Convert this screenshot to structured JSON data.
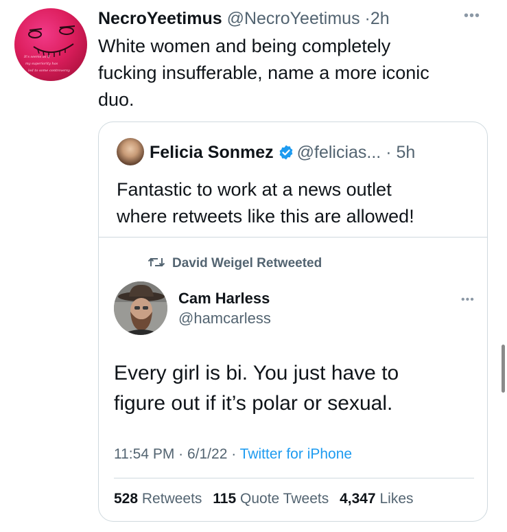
{
  "main_tweet": {
    "display_name": "NecroYeetimus",
    "handle": "@NecroYeetimus",
    "separator": "·",
    "time": "2h",
    "text_lines": [
      "White women and being completely",
      "fucking insufferable, name a more iconic",
      "duo."
    ],
    "avatar_text_lines": [
      "It's seems as if",
      "my superiority has",
      "led to some controversy"
    ],
    "more_icon": "more-horizontal-icon"
  },
  "quoted_tweet": {
    "display_name": "Felicia Sonmez",
    "verified_icon": "verified-badge-icon",
    "handle": "@felicias...",
    "separator": "·",
    "time": "5h",
    "text_lines": [
      "Fantastic to work at a news outlet",
      "where retweets like this are allowed!"
    ]
  },
  "embedded_tweet": {
    "retweet_icon": "retweet-icon",
    "retweeted_by": "David Weigel Retweeted",
    "display_name": "Cam Harless",
    "handle": "@hamcarless",
    "more_icon": "more-horizontal-icon",
    "text_lines": [
      "Every girl is bi. You just have to",
      "figure out if it’s polar or sexual."
    ],
    "timestamp": "11:54 PM · 6/1/22 · ",
    "source": "Twitter for iPhone",
    "stats": {
      "retweets_count": "528",
      "retweets_label": "Retweets",
      "quotes_count": "115",
      "quotes_label": "Quote Tweets",
      "likes_count": "4,347",
      "likes_label": "Likes"
    }
  },
  "colors": {
    "text": "#0f1419",
    "secondary": "#536471",
    "link": "#1d9bf0",
    "border": "#cfd9de",
    "verified": "#1d9bf0"
  }
}
